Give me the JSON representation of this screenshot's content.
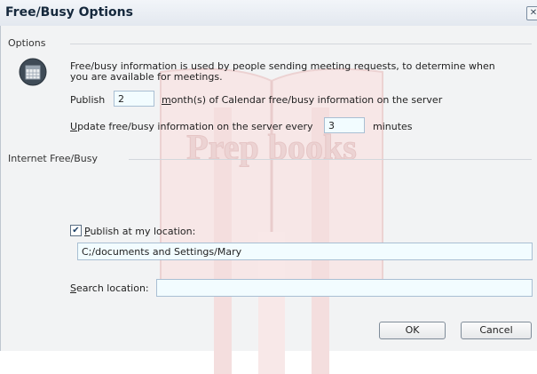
{
  "window": {
    "title": "Free/Busy Options",
    "close_glyph": "✕"
  },
  "options": {
    "group_label": "Options",
    "icon": "calendar-icon",
    "description_line1": "Free/busy information is used by people sending meeting requests, to determine when",
    "description_line2": "you are available for meetings.",
    "publish_prefix": "Publish",
    "publish_months": "2",
    "publish_suffix_key": "m",
    "publish_suffix_rest": "onth(s) of Calendar free/busy information on the server",
    "update_prefix_key": "U",
    "update_prefix_rest": "pdate free/busy information on the server every",
    "update_minutes": "3",
    "update_suffix": "minutes"
  },
  "internet": {
    "group_label": "Internet Free/Busy",
    "publish_checked": true,
    "publish_check_glyph": "✔",
    "publish_label_key": "P",
    "publish_label_rest": "ublish at my location:",
    "publish_location": "C;/documents and Settings/Mary",
    "search_label_key": "S",
    "search_label_rest": "earch location:",
    "search_location": ""
  },
  "buttons": {
    "ok": "OK",
    "cancel": "Cancel"
  },
  "watermark": "Prep books"
}
